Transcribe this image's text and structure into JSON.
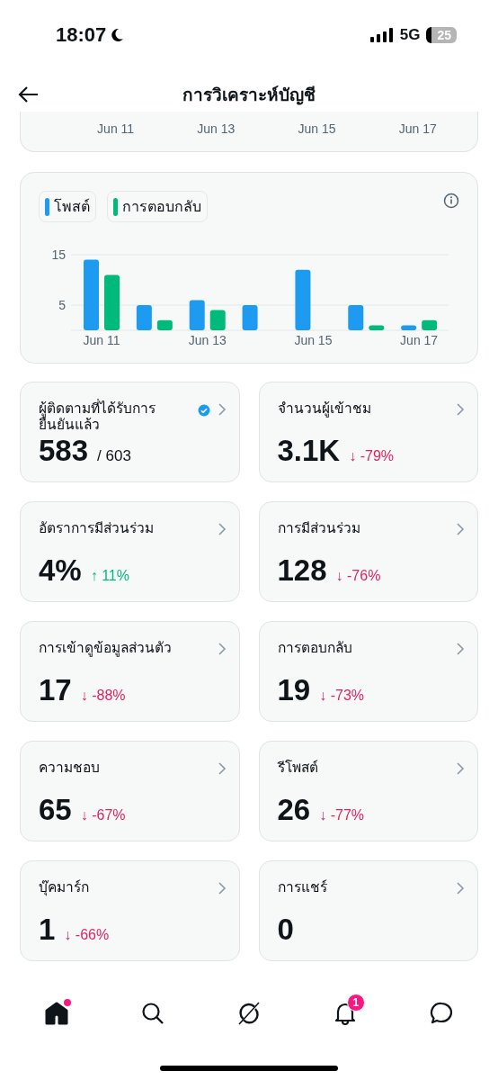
{
  "status_bar": {
    "time": "18:07",
    "network": "5G",
    "battery": "25"
  },
  "header": {
    "title": "การวิเคราะห์บัญชี"
  },
  "previous_chart": {
    "x_labels": [
      "Jun 11",
      "Jun 13",
      "Jun 15",
      "Jun 17"
    ]
  },
  "activity_chart": {
    "chart_data": {
      "type": "bar",
      "categories": [
        "Jun 11",
        null,
        "Jun 13",
        null,
        "Jun 15",
        null,
        "Jun 17"
      ],
      "series": [
        {
          "name": "โพสต์",
          "color": "#1d9bf0",
          "values": [
            14,
            5,
            6,
            5,
            12,
            5,
            1
          ]
        },
        {
          "name": "การตอบกลับ",
          "color": "#00ba7c",
          "values": [
            11,
            2,
            4,
            0,
            0,
            1,
            2
          ]
        }
      ],
      "ylim": [
        0,
        15
      ],
      "yticks": [
        5,
        15
      ]
    }
  },
  "metrics": [
    {
      "title": "ผู้ติดตามที่ได้รับการยืนยันแล้ว",
      "verified": true,
      "value": "583",
      "total": "/ 603"
    },
    {
      "title": "จำนวนผู้เข้าชม",
      "value": "3.1K",
      "change": "↓ -79%",
      "color": "#e0245e"
    },
    {
      "title": "อัตราการมีส่วนร่วม",
      "value": "4%",
      "change": "↑ 11%",
      "color": "#00ba7c"
    },
    {
      "title": "การมีส่วนร่วม",
      "value": "128",
      "change": "↓ -76%",
      "color": "#e0245e"
    },
    {
      "title": "การเข้าดูข้อมูลส่วนตัว",
      "value": "17",
      "change": "↓ -88%",
      "color": "#e0245e"
    },
    {
      "title": "การตอบกลับ",
      "value": "19",
      "change": "↓ -73%",
      "color": "#e0245e"
    },
    {
      "title": "ความชอบ",
      "value": "65",
      "change": "↓ -67%",
      "color": "#e0245e"
    },
    {
      "title": "รีโพสต์",
      "value": "26",
      "change": "↓ -77%",
      "color": "#e0245e"
    },
    {
      "title": "บุ๊คมาร์ก",
      "value": "1",
      "change": "↓ -66%",
      "color": "#e0245e"
    },
    {
      "title": "การแชร์",
      "value": "0"
    }
  ],
  "tab_bar": [
    {
      "kind": "home",
      "selected": true,
      "dot": true
    },
    {
      "kind": "search",
      "selected": false
    },
    {
      "kind": "grok",
      "selected": false
    },
    {
      "kind": "notifications",
      "selected": false,
      "badge": "1"
    },
    {
      "kind": "messages",
      "selected": false
    }
  ]
}
